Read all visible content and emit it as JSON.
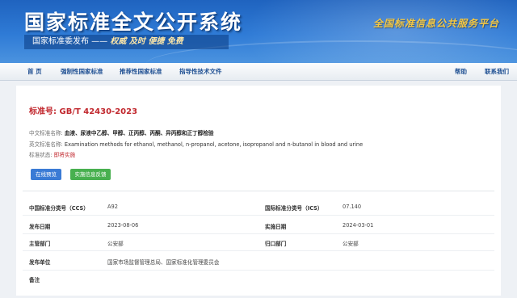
{
  "header": {
    "site_title": "国家标准全文公开系统",
    "tagline_prefix": "国家标准委发布 —— ",
    "tagline_motto": "权威 及时 便捷 免费",
    "platform_slogan": "全国标准信息公共服务平台"
  },
  "nav": {
    "home": "首 页",
    "mandatory": "强制性国家标准",
    "recommended": "推荐性国家标准",
    "guiding": "指导性技术文件",
    "help": "帮助",
    "contact": "联系我们"
  },
  "standard": {
    "number_label": "标准号:",
    "number": "GB/T 42430-2023",
    "cn_name_label": "中文标准名称:",
    "cn_name": "血液、尿液中乙醇、甲醇、正丙醇、丙酮、异丙醇和正丁醇检验",
    "en_name_label": "英文标准名称:",
    "en_name": "Examination methods for ethanol, methanol, n-propanol, acetone, isopropanol and n-butanol in blood and urine",
    "status_label": "标准状态:",
    "status": "即将实施"
  },
  "buttons": {
    "preview": "在线预览",
    "feedback": "实施信息反馈"
  },
  "details": {
    "ccs_label": "中国标准分类号（CCS）",
    "ccs_value": "A92",
    "ics_label": "国际标准分类号（ICS）",
    "ics_value": "07.140",
    "publish_date_label": "发布日期",
    "publish_date": "2023-08-06",
    "implement_date_label": "实施日期",
    "implement_date": "2024-03-01",
    "competent_dept_label": "主管部门",
    "competent_dept": "公安部",
    "centralized_dept_label": "归口部门",
    "centralized_dept": "公安部",
    "issuer_label": "发布单位",
    "issuer": "国家市场监督管理总局、国家标准化管理委员会",
    "remarks_label": "备注",
    "remarks": ""
  },
  "colors": {
    "header_blue": "#2f7bd6",
    "accent_red": "#c1272d",
    "preview_button": "#3a7bd5",
    "feedback_button": "#48b04f",
    "nav_text": "#1e4f92"
  }
}
